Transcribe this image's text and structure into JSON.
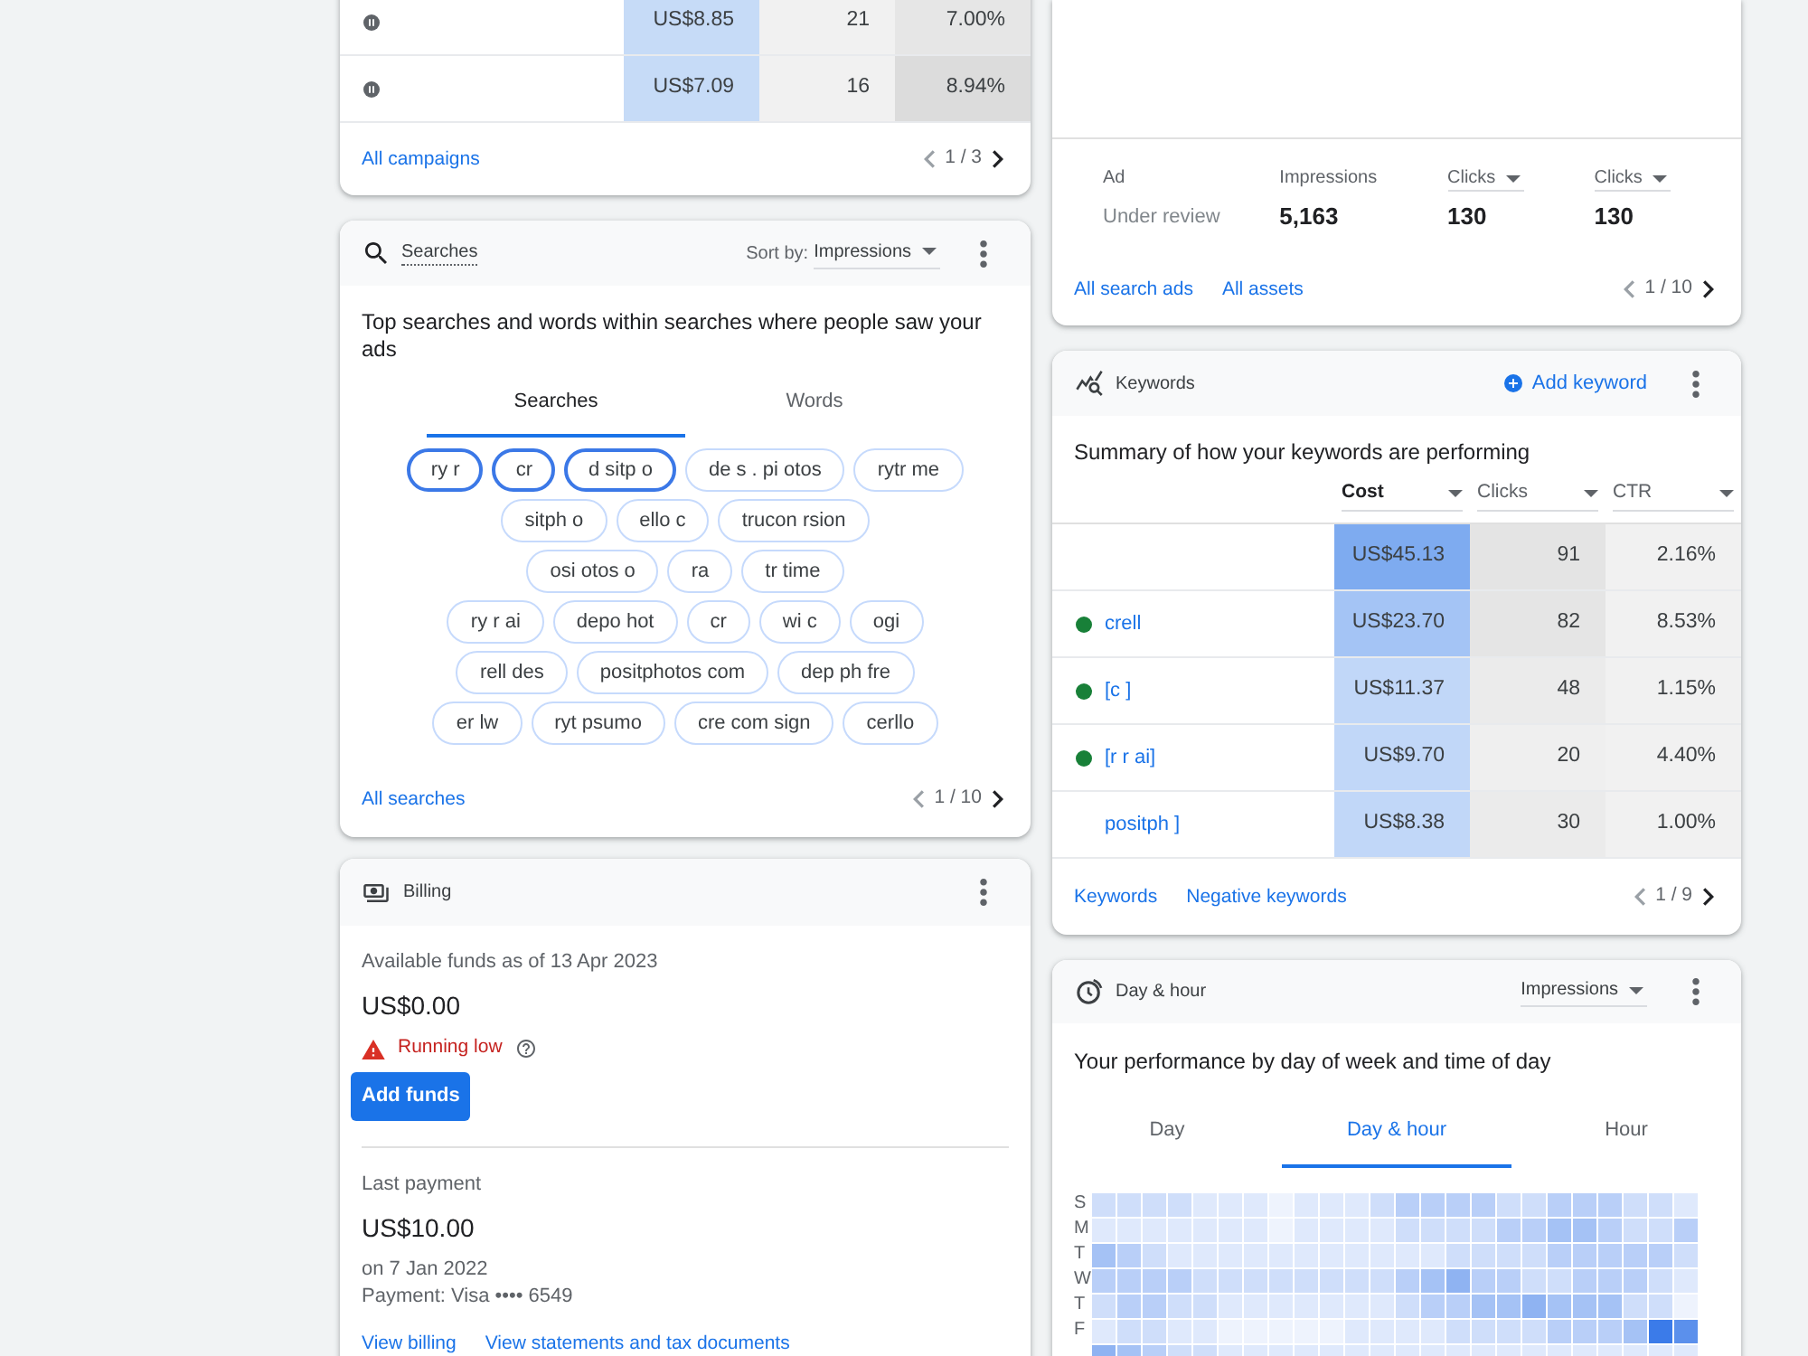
{
  "campaigns": {
    "rows": [
      {
        "kind": "paused",
        "cost": {
          "text": "US$8.85",
          "color": "#c6dbf7"
        },
        "clicks": {
          "text": "21",
          "color": "#f1f1f1"
        },
        "ctr": {
          "text": "7.00%",
          "color": "#e6e6e6"
        }
      },
      {
        "kind": "paused",
        "cost": {
          "text": "US$7.09",
          "color": "#c6dbf7"
        },
        "clicks": {
          "text": "16",
          "color": "#f1f1f1"
        },
        "ctr": {
          "text": "8.94%",
          "color": "#dcdcdc"
        }
      }
    ],
    "links": [
      "All campaigns"
    ],
    "pagination": {
      "text": "1 / 3",
      "prev_disabled": true,
      "next_disabled": false
    }
  },
  "searches": {
    "title": "Searches",
    "sort_label": "Sort by:",
    "sort_value": "Impressions",
    "description": "Top searches and words within searches where people saw your ads",
    "tabs": [
      {
        "label": "Searches",
        "selected": true
      },
      {
        "label": "Words",
        "selected": false
      }
    ],
    "chip_rows": [
      [
        {
          "label": "ry r",
          "highlighted": true
        },
        {
          "label": "cr",
          "highlighted": true
        },
        {
          "label": "d sitp o",
          "highlighted": true
        },
        {
          "label": "de s . pi otos",
          "highlighted": false
        },
        {
          "label": "rytr me",
          "highlighted": false
        }
      ],
      [
        {
          "label": "sitph o",
          "highlighted": false
        },
        {
          "label": "ello c",
          "highlighted": false
        },
        {
          "label": "trucon rsion",
          "highlighted": false
        }
      ],
      [
        {
          "label": "osi otos o",
          "highlighted": false
        },
        {
          "label": "ra",
          "highlighted": false
        },
        {
          "label": "tr time",
          "highlighted": false
        }
      ],
      [
        {
          "label": "ry r ai",
          "highlighted": false
        },
        {
          "label": "depo hot",
          "highlighted": false
        },
        {
          "label": "cr",
          "highlighted": false
        },
        {
          "label": "wi c",
          "highlighted": false
        },
        {
          "label": "ogi",
          "highlighted": false
        }
      ],
      [
        {
          "label": "rell des",
          "highlighted": false
        },
        {
          "label": "positphotos com",
          "highlighted": false
        },
        {
          "label": "dep ph fre",
          "highlighted": false
        }
      ],
      [
        {
          "label": "er lw",
          "highlighted": false
        },
        {
          "label": "ryt psumo",
          "highlighted": false
        },
        {
          "label": "cre com sign",
          "highlighted": false
        },
        {
          "label": "cerllo",
          "highlighted": false
        }
      ]
    ],
    "links": [
      "All searches"
    ],
    "pagination": {
      "text": "1 / 10",
      "prev_disabled": true,
      "next_disabled": false
    }
  },
  "billing": {
    "title": "Billing",
    "funds_label": "Available funds as of 13 Apr 2023",
    "funds_amount": "US$0.00",
    "warning": "Running low",
    "add_button": "Add funds",
    "last_payment_label": "Last payment",
    "last_payment_amount": "US$10.00",
    "last_payment_date": "on 7 Jan 2022",
    "payment_method": "Payment: Visa •••• 6549",
    "links": [
      "View billing",
      "View statements and tax documents"
    ]
  },
  "ads": {
    "stats": [
      {
        "kind": "text",
        "label": "Ad",
        "value": "Under review"
      },
      {
        "kind": "metric",
        "label": "Impressions",
        "value": "5,163"
      },
      {
        "kind": "dropdown",
        "label": "Clicks",
        "value": "130"
      },
      {
        "kind": "dropdown",
        "label": "Clicks",
        "value": "130"
      }
    ],
    "links": [
      "All search ads",
      "All assets"
    ],
    "pagination": {
      "text": "1 / 10",
      "prev_disabled": true,
      "next_disabled": false
    }
  },
  "keywords": {
    "title": "Keywords",
    "add_button": "Add keyword",
    "description": "Summary of how your keywords are performing",
    "columns": [
      {
        "label": "Cost",
        "sorted": true
      },
      {
        "label": "Clicks",
        "sorted": false
      },
      {
        "label": "CTR",
        "sorted": false
      }
    ],
    "rows": [
      {
        "cost": {
          "text": "US$45.13",
          "color": "#7eabf0"
        },
        "clicks": {
          "text": "91",
          "color": "#e4e4e4"
        },
        "ctr": {
          "text": "2.16%",
          "color": "#f1f1f1"
        }
      },
      {
        "kind": "enabled",
        "name": "crell",
        "cost": {
          "text": "US$23.70",
          "color": "#a4c4f5"
        },
        "clicks": {
          "text": "82",
          "color": "#e5e5e5"
        },
        "ctr": {
          "text": "8.53%",
          "color": "#f1f1f1"
        }
      },
      {
        "kind": "enabled",
        "name": "[c ]",
        "cost": {
          "text": "US$11.37",
          "color": "#c1d7f8"
        },
        "clicks": {
          "text": "48",
          "color": "#ebebeb"
        },
        "ctr": {
          "text": "1.15%",
          "color": "#f1f1f1"
        }
      },
      {
        "kind": "enabled",
        "name": "[r r ai]",
        "cost": {
          "text": "US$9.70",
          "color": "#c1d7f8"
        },
        "clicks": {
          "text": "20",
          "color": "#efefef"
        },
        "ctr": {
          "text": "4.40%",
          "color": "#f1f1f1"
        }
      },
      {
        "name": "positph ]",
        "cost": {
          "text": "US$8.38",
          "color": "#c1d7f8"
        },
        "clicks": {
          "text": "30",
          "color": "#ebebeb"
        },
        "ctr": {
          "text": "1.00%",
          "color": "#f1f1f1"
        }
      }
    ],
    "links": [
      "Keywords",
      "Negative keywords"
    ],
    "pagination": {
      "text": "1 / 9",
      "prev_disabled": true,
      "next_disabled": false
    }
  },
  "day_hour": {
    "title": "Day & hour",
    "metric": "Impressions",
    "description": "Your performance by day of week and time of day",
    "tabs": [
      {
        "label": "Day",
        "selected": false
      },
      {
        "label": "Day & hour",
        "selected": true
      },
      {
        "label": "Hour",
        "selected": false
      }
    ],
    "day_labels": [
      "S",
      "M",
      "T",
      "W",
      "T",
      "F"
    ]
  }
}
